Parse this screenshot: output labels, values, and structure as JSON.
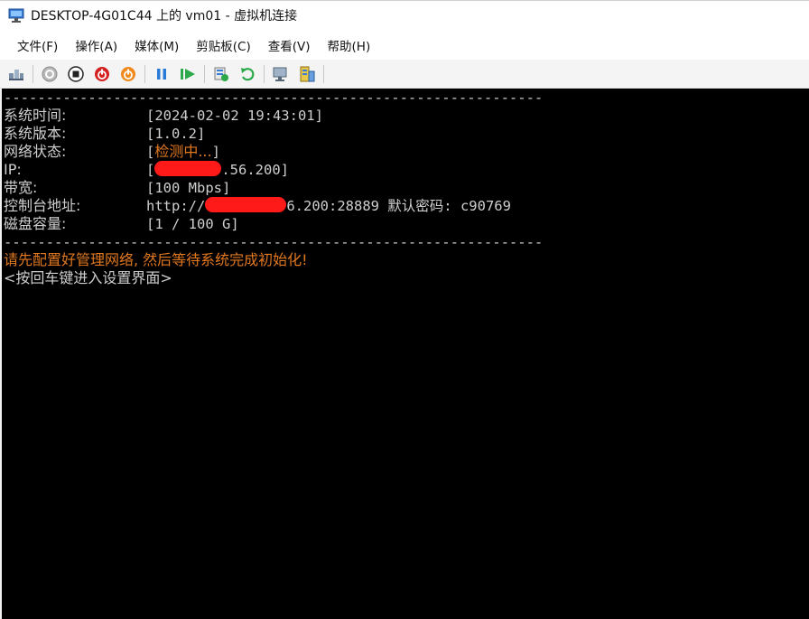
{
  "window": {
    "title": "DESKTOP-4G01C44 上的 vm01 - 虚拟机连接"
  },
  "menu": {
    "items": [
      "文件(F)",
      "操作(A)",
      "媒体(M)",
      "剪贴板(C)",
      "查看(V)",
      "帮助(H)"
    ]
  },
  "toolbar": {
    "icons": [
      "ctrl-alt-del-icon",
      "start-icon",
      "turn-off-icon",
      "shutdown-icon",
      "power-icon",
      "pause-icon",
      "resume-icon",
      "checkpoint-icon",
      "revert-icon",
      "enhanced-session-icon",
      "share-icon"
    ]
  },
  "console": {
    "divider": "----------------------------------------------------------------",
    "system_time_label": "系统时间:",
    "system_time_value": "[2024-02-02 19:43:01]",
    "version_label": "系统版本:",
    "version_value": "[1.0.2]",
    "network_label": "网络状态:",
    "network_open": "[",
    "network_value": "检测中...",
    "network_close": "]",
    "ip_label": "IP:",
    "ip_open": "[",
    "ip_value_suffix": ".56.200]",
    "bandwidth_label": "带宽:",
    "bandwidth_value": "[100 Mbps]",
    "console_label": "控制台地址:",
    "console_prefix": "http://",
    "console_suffix": "6.200:28889 默认密码: c90769",
    "disk_label": "磁盘容量:",
    "disk_value": "[1 / 100 G]",
    "warning": "请先配置好管理网络, 然后等待系统完成初始化!",
    "prompt": "<按回车键进入设置界面>"
  },
  "colors": {
    "console_bg": "#000000",
    "console_text": "#cfcfcf",
    "highlight": "#e07820",
    "redaction": "#ff1a1a"
  }
}
